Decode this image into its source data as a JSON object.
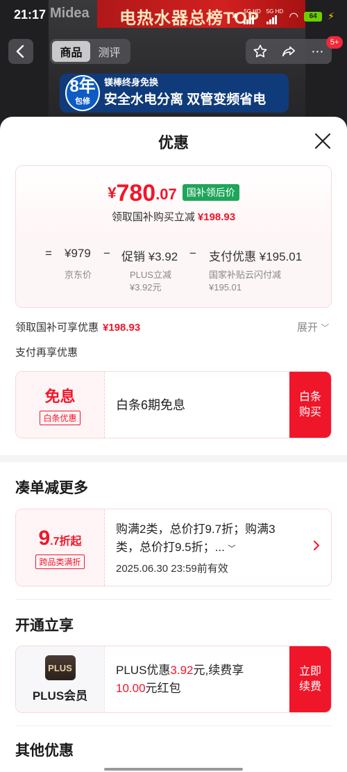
{
  "status_bar": {
    "time": "21:17",
    "signal1": "5G HD",
    "signal2": "5G HD",
    "battery": "64"
  },
  "background": {
    "brand": "Midea",
    "banner_text": "电热水器总榜TOP",
    "badge_num": "8年",
    "badge_sub": "包修",
    "tagline1": "镁棒终身免换",
    "tagline2": "安全水电分离 双管变频省电"
  },
  "nav": {
    "tabs": [
      "商品",
      "测评"
    ],
    "notif_badge": "5+"
  },
  "sheet": {
    "title": "优惠",
    "price": {
      "yen": "¥",
      "integer": "780",
      "decimal": ".07",
      "tag": "国补领后价",
      "sub_label": "领取国补购买立减",
      "sub_value": "¥198.93"
    },
    "calc": {
      "eq": "=",
      "jd_price": "¥979",
      "minus1": "−",
      "promo": "促销 ¥3.92",
      "minus2": "−",
      "pay": "支付优惠 ¥195.01",
      "jd_label": "京东价",
      "plus_label": "PLUS立减",
      "plus_value": "¥3.92元",
      "subsidy_label": "国家补贴云闪付减",
      "subsidy_value": "¥195.01"
    },
    "subsidy_line": {
      "label": "领取国补可享优惠",
      "value": "¥198.93",
      "expand": "展开"
    },
    "pay_more": "支付再享优惠",
    "baitiao": {
      "title": "免息",
      "tag": "白条优惠",
      "desc": "白条6期免息",
      "button_line1": "白条",
      "button_line2": "购买"
    }
  },
  "bundle": {
    "section_title": "凑单减更多",
    "discount_big": "9",
    "discount_small": ".7折起",
    "tag": "跨品类满折",
    "desc_line1": "购满2类，总价打9.7折；购满3",
    "desc_line2": "类，总价打9.5折；...",
    "deadline": "2025.06.30 23:59前有效"
  },
  "plus": {
    "section_title": "开通立享",
    "logo_text": "PLUS",
    "name": "PLUS会员",
    "desc_a": "PLUS优惠",
    "desc_b": "3.92",
    "desc_c": "元,续费享",
    "desc_d": "10.00",
    "desc_e": "元红包",
    "button_line1": "立即",
    "button_line2": "续费"
  },
  "other": {
    "section_title": "其他优惠"
  },
  "colors": {
    "accent_red": "#f0162a",
    "green_tag": "#1fa55a"
  }
}
